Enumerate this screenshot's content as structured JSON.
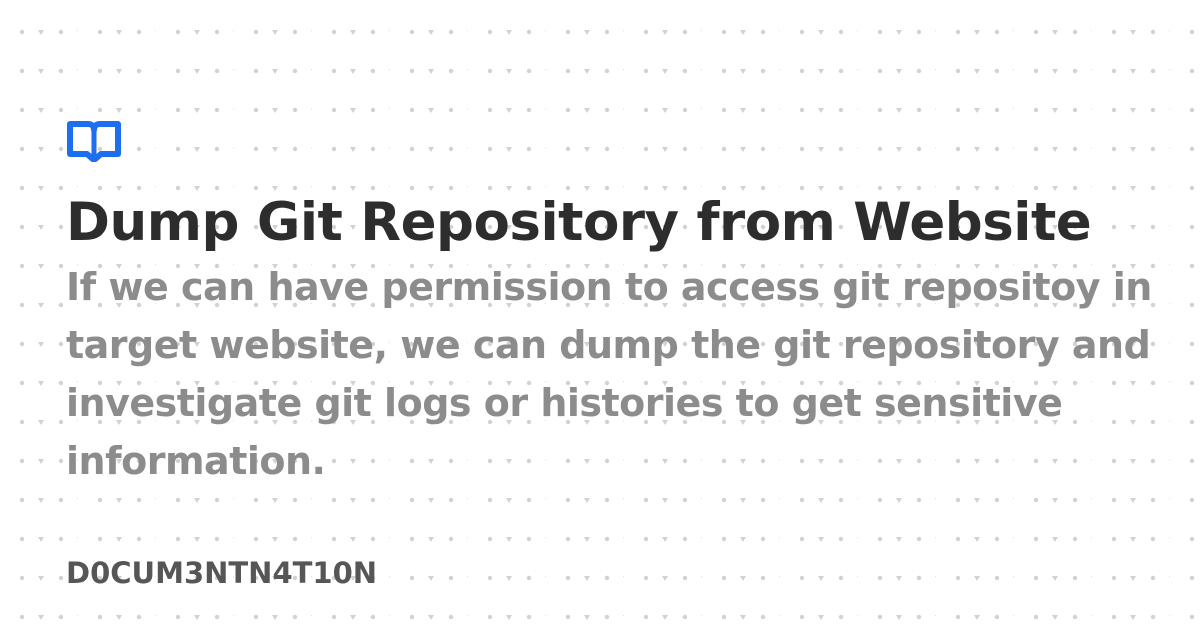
{
  "logo": {
    "icon": "book-open-icon",
    "color": "#1e6ff0"
  },
  "title": "Dump Git Repository from Website",
  "description": "If we can have permission to access git repositoy in target website, we can dump the git repository and investigate git logs or histories to get sensitive information.",
  "footer": {
    "site_name": "D0CUM3NTN4T10N"
  },
  "colors": {
    "background": "#ffffff",
    "title": "#2d2d2d",
    "description": "#8c8c8c",
    "footer": "#565656",
    "pattern": "#d2d2d2"
  }
}
